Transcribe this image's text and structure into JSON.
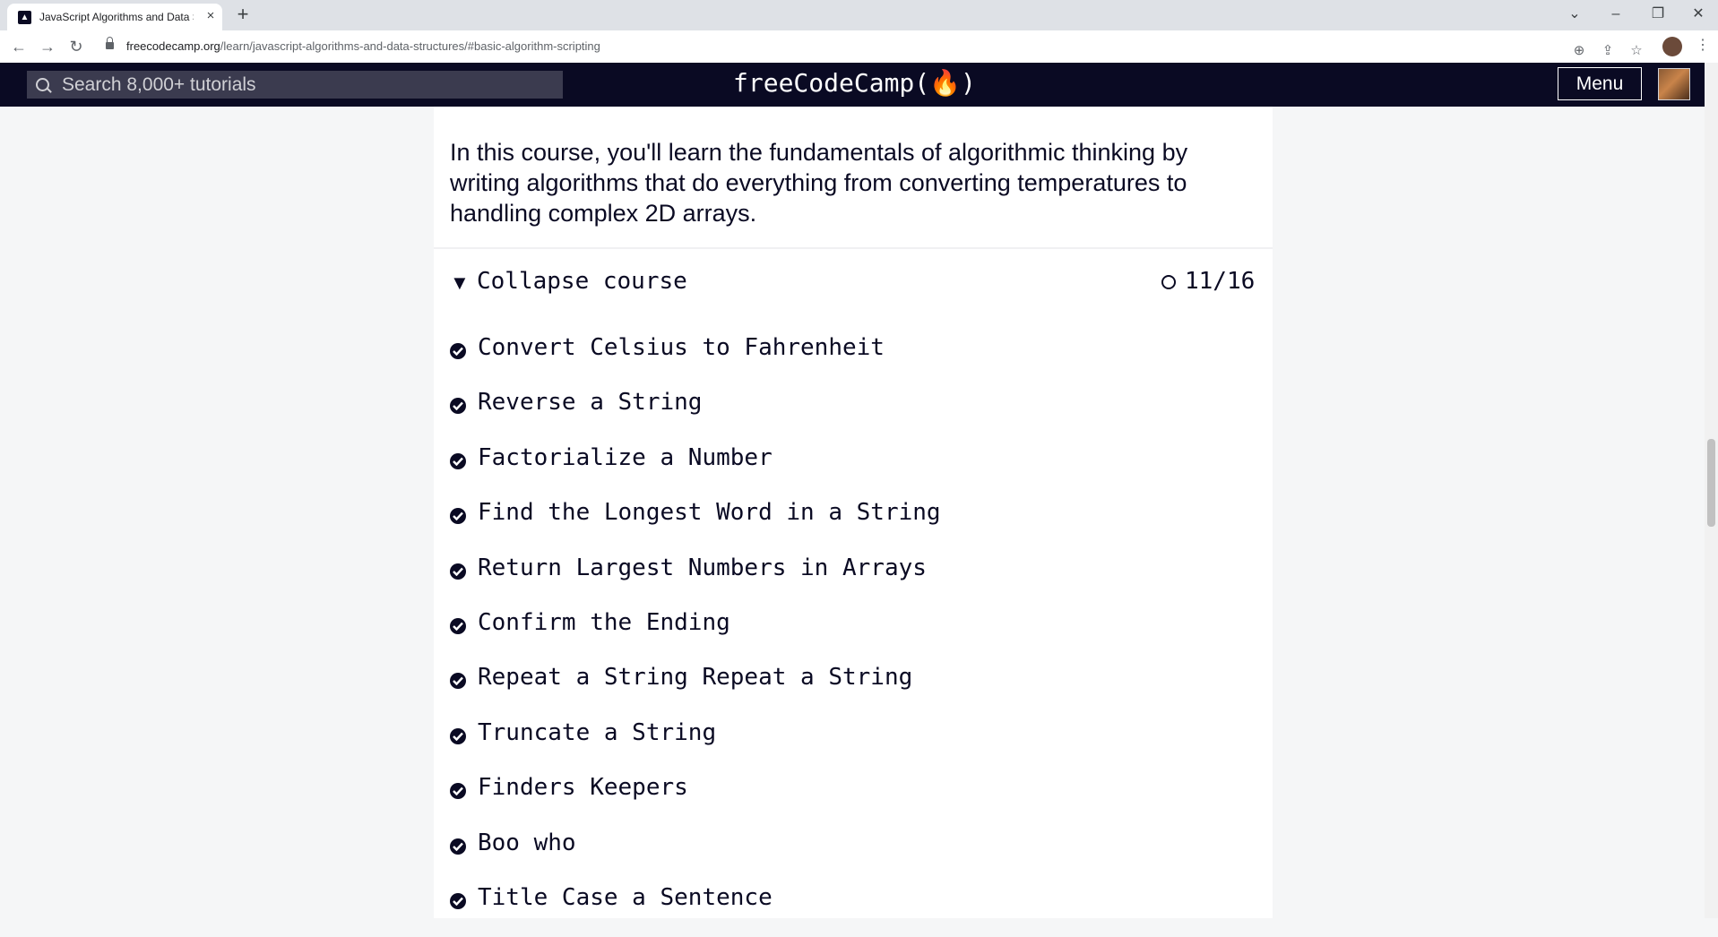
{
  "browser": {
    "tab_title": "JavaScript Algorithms and Data S",
    "tab_close": "×",
    "new_tab": "+",
    "url_host": "freecodecamp.org",
    "url_path": "/learn/javascript-algorithms-and-data-structures/#basic-algorithm-scripting"
  },
  "navbar": {
    "search_placeholder": "Search 8,000+ tutorials",
    "logo": "freeCodeCamp(🔥)",
    "menu_label": "Menu"
  },
  "course": {
    "intro": "In this course, you'll learn the fundamentals of algorithmic thinking by writing algorithms that do everything from converting temperatures to handling complex 2D arrays.",
    "collapse_label": "Collapse course",
    "collapse_arrow": "▼",
    "progress": "11/16",
    "lessons": [
      {
        "label": "Convert Celsius to Fahrenheit",
        "completed": true
      },
      {
        "label": "Reverse a String",
        "completed": true
      },
      {
        "label": "Factorialize a Number",
        "completed": true
      },
      {
        "label": "Find the Longest Word in a String",
        "completed": true
      },
      {
        "label": "Return Largest Numbers in Arrays",
        "completed": true
      },
      {
        "label": "Confirm the Ending",
        "completed": true
      },
      {
        "label": "Repeat a String Repeat a String",
        "completed": true
      },
      {
        "label": "Truncate a String",
        "completed": true
      },
      {
        "label": "Finders Keepers",
        "completed": true
      },
      {
        "label": "Boo who",
        "completed": true
      },
      {
        "label": "Title Case a Sentence",
        "completed": true
      }
    ]
  },
  "colors": {
    "navbar_bg": "#0a0a23",
    "search_bg": "#3b3b4f",
    "text": "#0a0a23",
    "page_bg": "#f5f6f7"
  }
}
